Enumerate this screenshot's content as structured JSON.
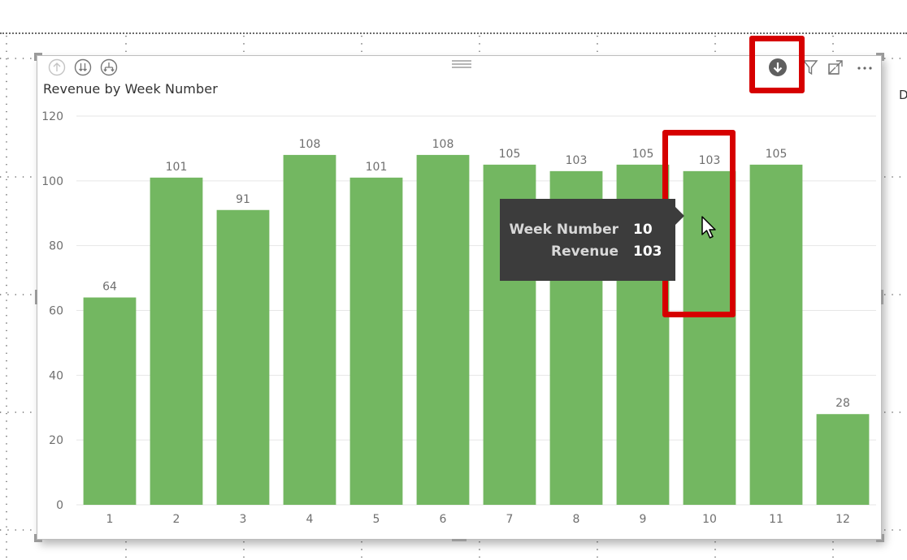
{
  "visual": {
    "title": "Revenue by Week Number",
    "header_icons": [
      "drill-up-icon",
      "expand-all-down-icon",
      "hierarchy-expand-icon",
      "drill-down-mode-icon",
      "filter-icon",
      "focus-mode-icon",
      "more-options-icon"
    ]
  },
  "chart_data": {
    "type": "bar",
    "title": "Revenue by Week Number",
    "xlabel": "",
    "ylabel": "",
    "categories": [
      "1",
      "2",
      "3",
      "4",
      "5",
      "6",
      "7",
      "8",
      "9",
      "10",
      "11",
      "12"
    ],
    "values": [
      64,
      101,
      91,
      108,
      101,
      108,
      105,
      103,
      105,
      103,
      105,
      28
    ],
    "ylim": [
      0,
      120
    ],
    "yticks": [
      0,
      20,
      40,
      60,
      80,
      100,
      120
    ],
    "grid": true,
    "data_labels": true,
    "bar_color": "#73b761"
  },
  "tooltip": {
    "rows": [
      {
        "label": "Week Number",
        "value": "10"
      },
      {
        "label": "Revenue",
        "value": "103"
      }
    ]
  },
  "highlight_color": "#d60000",
  "edge_text": "D"
}
